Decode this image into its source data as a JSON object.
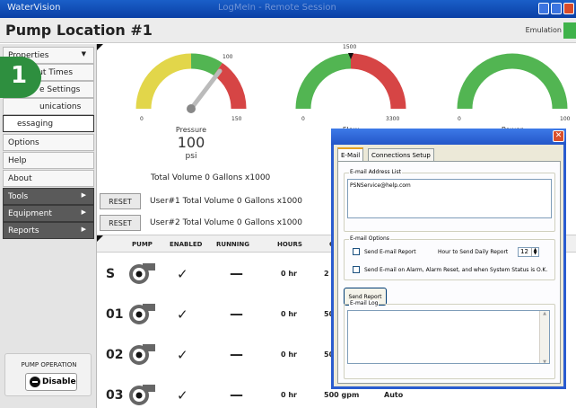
{
  "window": {
    "app_title": "WaterVision",
    "center_title": "LogMeIn - Remote Session"
  },
  "header": {
    "title": "Pump Location #1",
    "emulation_label": "Emulation",
    "emulation_color": "#3fb24a"
  },
  "badge": {
    "text": "1"
  },
  "sidebar": {
    "items": [
      {
        "label": "Properties",
        "has_menu": true
      },
      {
        "label": "Shout Times",
        "visible_label": "hout Times"
      },
      {
        "label": "Device Settings",
        "visible_label": "e Settings"
      },
      {
        "label": "Communications",
        "visible_label": "unications"
      },
      {
        "label": "Messaging",
        "visible_label": "essaging",
        "active": true
      },
      {
        "label": "Options"
      },
      {
        "label": "Help"
      },
      {
        "label": "About"
      },
      {
        "label": "Tools",
        "has_menu": true
      },
      {
        "label": "Equipment",
        "has_menu": true
      },
      {
        "label": "Reports",
        "has_menu": true
      }
    ],
    "pump_operation": {
      "label": "PUMP OPERATION",
      "button": "Disable"
    }
  },
  "gauges": [
    {
      "name": "Pressure",
      "min": "0",
      "max": "150",
      "marker": "100",
      "needle_fraction": 0.62
    },
    {
      "name": "Flow",
      "min": "0",
      "max": "3300",
      "marker": "1500",
      "needle_fraction": 0.5
    },
    {
      "name": "Power",
      "min": "0",
      "max": "100",
      "marker": "",
      "needle_fraction": 0.0
    }
  ],
  "pressure_readout": {
    "value": "100",
    "unit": "psi"
  },
  "volumes": {
    "total": "Total Volume 0 Gallons x1000",
    "reset_label": "RESET",
    "user1": "User#1 Total Volume 0 Gallons x1000",
    "user2": "User#2 Total Volume 0 Gallons x1000"
  },
  "table": {
    "headers": {
      "pump": "PUMP",
      "enabled": "ENABLED",
      "running": "RUNNING",
      "hours": "HOURS",
      "c": "C"
    },
    "rows": [
      {
        "id": "S",
        "enabled": "✓",
        "running": "—",
        "hours": "0 hr",
        "flow": "2",
        "mode": ""
      },
      {
        "id": "01",
        "enabled": "✓",
        "running": "—",
        "hours": "0 hr",
        "flow": "50",
        "mode": ""
      },
      {
        "id": "02",
        "enabled": "✓",
        "running": "—",
        "hours": "0 hr",
        "flow": "50",
        "mode": ""
      },
      {
        "id": "03",
        "enabled": "✓",
        "running": "—",
        "hours": "0 hr",
        "flow": "500 gpm",
        "mode": "Auto"
      }
    ]
  },
  "dialog": {
    "tabs": [
      "E-Mail",
      "Connections Setup"
    ],
    "address_list_title": "E-mail Address List",
    "address": "PSNService@help.com",
    "options_title": "E-mail Options",
    "send_report_label": "Send E-mail Report",
    "hour_label": "Hour to Send Daily Report",
    "hour_value": "12",
    "alarm_label": "Send E-mail on Alarm, Alarm Reset, and when System Status is O.K.",
    "send_button": "Send Report",
    "log_title": "E-mail Log",
    "close_glyph": "✕"
  },
  "colors": {
    "gauge_yellow": "#e2d64a",
    "gauge_green": "#52b552",
    "gauge_red": "#d64545",
    "accent_blue": "#2a5ccf"
  }
}
